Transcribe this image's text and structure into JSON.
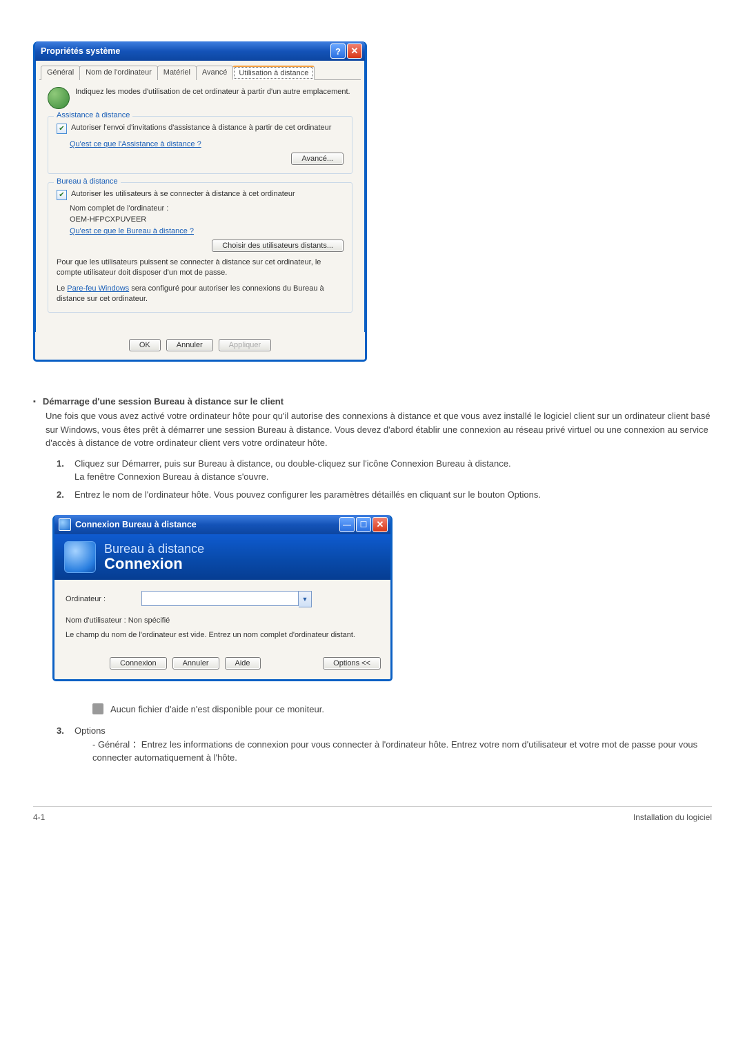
{
  "sysprops": {
    "title": "Propriétés système",
    "tabs": {
      "general": "Général",
      "computer_name": "Nom de l'ordinateur",
      "hardware": "Matériel",
      "advanced": "Avancé",
      "remote": "Utilisation à distance"
    },
    "intro": "Indiquez les modes d'utilisation de cet ordinateur à partir d'un autre emplacement.",
    "group_assist": {
      "title": "Assistance à distance",
      "checkbox": "Autoriser l'envoi d'invitations d'assistance à distance à partir de cet ordinateur",
      "link": "Qu'est ce que l'Assistance à distance ?",
      "adv_btn": "Avancé..."
    },
    "group_bureau": {
      "title": "Bureau à distance",
      "checkbox": "Autoriser les utilisateurs à se connecter à distance à cet ordinateur",
      "fullname_label": "Nom complet de l'ordinateur :",
      "fullname_value": "OEM-HFPCXPUVEER",
      "link": "Qu'est ce que le Bureau à distance ?",
      "choose_btn": "Choisir des utilisateurs distants...",
      "note1": "Pour que les utilisateurs puissent se connecter à distance sur cet ordinateur, le compte utilisateur doit disposer d'un mot de passe.",
      "note2a": "Le ",
      "note2_link": "Pare-feu Windows",
      "note2b": " sera configuré pour autoriser les connexions du Bureau à distance sur cet ordinateur."
    },
    "footer": {
      "ok": "OK",
      "cancel": "Annuler",
      "apply": "Appliquer"
    }
  },
  "doc": {
    "h": "Démarrage d'une session Bureau à distance sur le client",
    "p": "Une fois que vous avez activé votre ordinateur hôte pour qu'il autorise des connexions à distance et que vous avez installé le logiciel client sur un ordinateur client basé sur Windows, vous êtes prêt à démarrer une session Bureau à distance. Vous devez d'abord établir une connexion au réseau privé virtuel ou une connexion au service d'accès à distance de votre ordinateur client vers votre ordinateur hôte.",
    "li1a": "Cliquez sur Démarrer, puis sur Bureau à distance, ou double-cliquez sur l'icône Connexion Bureau à distance.",
    "li1b": "La fenêtre Connexion Bureau à distance s'ouvre.",
    "li2": "Entrez le nom de l'ordinateur hôte. Vous pouvez configurer les paramètres détaillés en cliquant sur le bouton Options.",
    "note_nofile": "Aucun fichier d'aide n'est disponible pour ce moniteur.",
    "li3": "Options",
    "li3_sub": "-  Général ：Entrez les informations de connexion pour vous connecter à l'ordinateur hôte. Entrez votre nom d'utilisateur et votre mot de passe pour vous connecter automatiquement à l'hôte."
  },
  "rdp": {
    "title": "Connexion Bureau à distance",
    "banner_l1": "Bureau à distance",
    "banner_l2": "Connexion",
    "field_computer": "Ordinateur :",
    "user_label": "Nom d'utilisateur : ",
    "user_value": "Non  spécifié",
    "hint": "Le champ du nom de l'ordinateur est vide. Entrez un nom complet d'ordinateur distant.",
    "btn_connect": "Connexion",
    "btn_cancel": "Annuler",
    "btn_help": "Aide",
    "btn_options": "Options <<"
  },
  "footer": {
    "left": "4-1",
    "right": "Installation du logiciel"
  }
}
